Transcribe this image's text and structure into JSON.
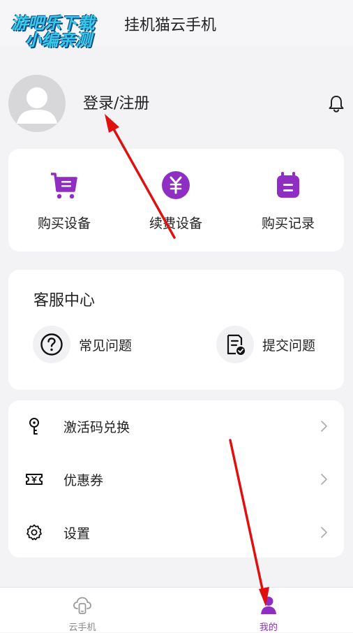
{
  "header": {
    "watermark_line1": "游吧乐下载",
    "watermark_line2": "小编亲测",
    "title": "挂机猫云手机"
  },
  "profile": {
    "login_label": "登录/注册"
  },
  "actions": [
    {
      "label": "购买设备",
      "icon": "shopping-cart-icon"
    },
    {
      "label": "续费设备",
      "icon": "yuan-coin-icon"
    },
    {
      "label": "购买记录",
      "icon": "calendar-record-icon"
    }
  ],
  "service": {
    "title": "客服中心",
    "items": [
      {
        "label": "常见问题",
        "icon": "question-icon"
      },
      {
        "label": "提交问题",
        "icon": "document-check-icon"
      }
    ]
  },
  "menu": [
    {
      "label": "激活码兑换",
      "icon": "key-icon"
    },
    {
      "label": "优惠券",
      "icon": "coupon-icon"
    },
    {
      "label": "设置",
      "icon": "gear-icon"
    }
  ],
  "tabbar": {
    "tabs": [
      {
        "label": "云手机",
        "icon": "cloud-phone-icon",
        "active": false
      },
      {
        "label": "我的",
        "icon": "user-icon",
        "active": true
      }
    ]
  },
  "colors": {
    "accent": "#8e2ec2",
    "annotation_arrow": "#e01010"
  }
}
